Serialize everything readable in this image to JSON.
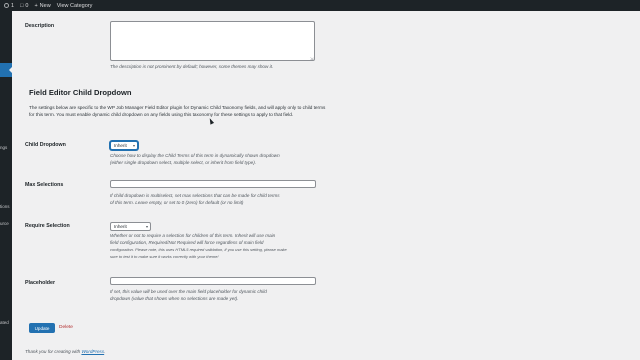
{
  "admin_bar": {
    "updates_count": "1",
    "comments_count": "0",
    "new_label": "New",
    "view_label": "View Category"
  },
  "sidebar": {
    "partial_labels": [
      "ngs",
      "tions",
      "urce",
      "ated"
    ]
  },
  "description_field": {
    "label": "Description",
    "value": "",
    "help": "The description is not prominent by default; however, some themes may show it."
  },
  "section": {
    "title": "Field Editor Child Dropdown",
    "intro": "The settings below are specific to the WP Job Manager Field Editor plugin for Dynamic Child Taxonomy fields, and will apply only to child terms for this term. You must enable dynamic child dropdown on any fields using this taxonomy for these settings to apply to that field."
  },
  "child_dropdown": {
    "label": "Child Dropdown",
    "selected": "Inherit",
    "help_line1": "Choose how to display the Child Terms of this term in dynamically shown dropdown",
    "help_line2": "(either single dropdown select, multiple select, or inherit from field type)."
  },
  "max_selections": {
    "label": "Max Selections",
    "value": "",
    "help_line1": "If child dropdown is multiselect, set max selections that can be made for child terms",
    "help_line2": "of this term. Leave empty, or set to 0 (zero) for default (or no limit)"
  },
  "require_selection": {
    "label": "Require Selection",
    "selected": "Inherit",
    "help_line1": "Whether or not to require a selection for children of this term. Inherit will use main",
    "help_line2": "field configuration, Required/Not Required will force regardless of main field",
    "help_line3": "configuration. Please note, this uses HTML5 required validation, if you use this setting, please make",
    "help_line4": "sure to test it to make sure it works correctly with your theme!"
  },
  "placeholder": {
    "label": "Placeholder",
    "value": "",
    "help_line1": "If set, this value will be used over the main field placeholder for dynamic child",
    "help_line2": "dropdown (value that shows when no selections are made yet)."
  },
  "actions": {
    "update_label": "Update",
    "delete_label": "Delete"
  },
  "footer": {
    "prefix": "Thank you for creating with ",
    "link": "WordPress",
    "suffix": "."
  },
  "colors": {
    "primary": "#2271b1",
    "danger": "#b32d2e",
    "admin_bar": "#1d2327",
    "background": "#f0f0f1"
  },
  "icons": [
    "wordpress-logo-icon",
    "updates-icon",
    "comment-icon",
    "plus-icon",
    "chevron-down-icon"
  ]
}
